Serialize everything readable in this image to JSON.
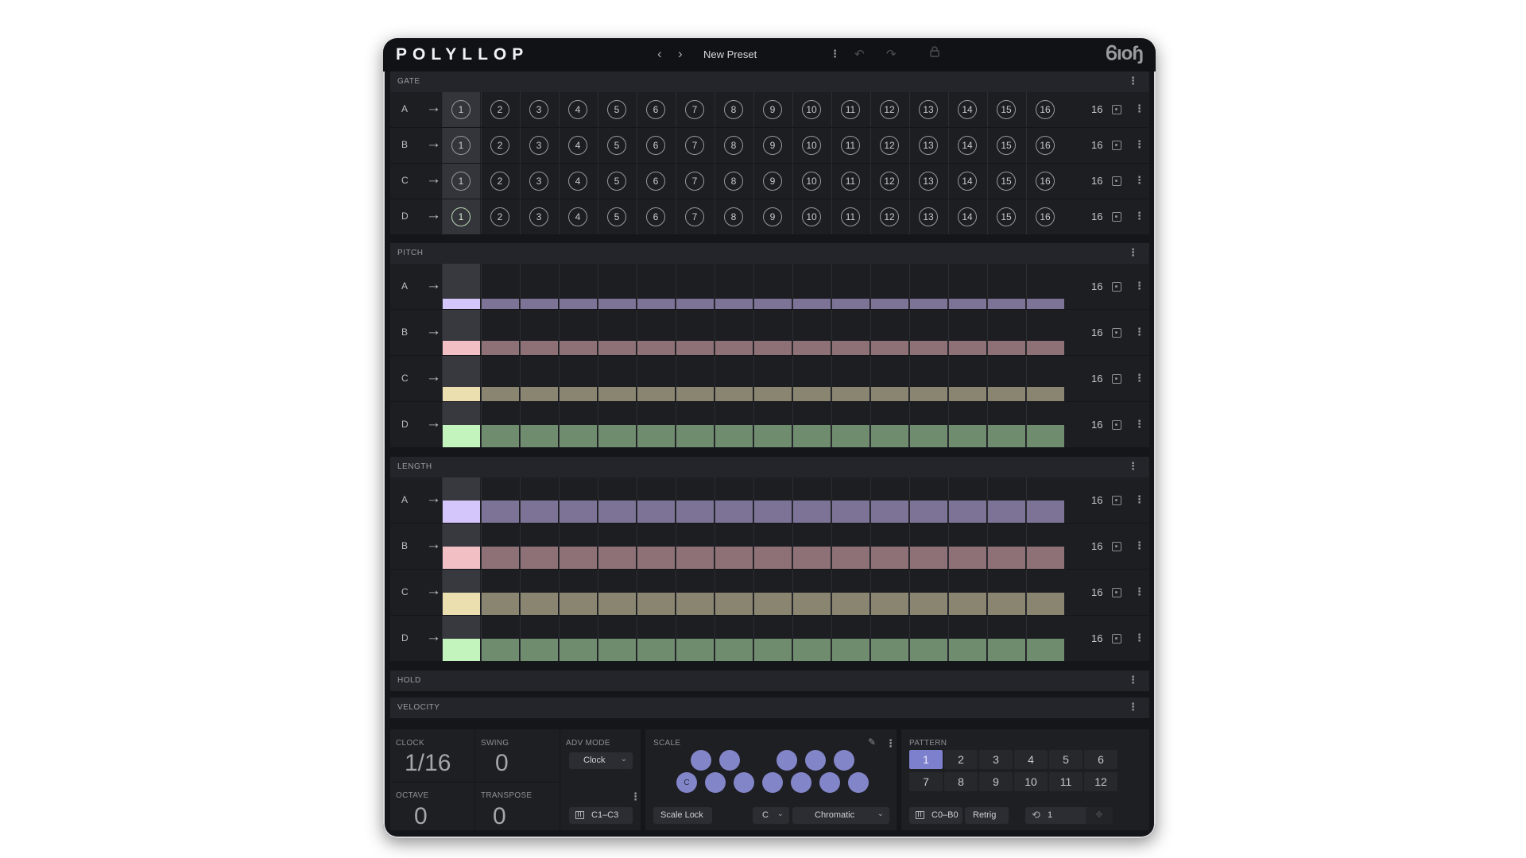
{
  "header": {
    "logo": "POLYLLOP",
    "prev_icon": "chevron-left",
    "next_icon": "chevron-right",
    "preset_name": "New Preset",
    "menu_icon": "kebab",
    "undo_icon": "undo",
    "redo_icon": "redo",
    "lock_icon": "lock",
    "brand": "Ꮾıoɧ"
  },
  "sections": {
    "gate": "GATE",
    "pitch": "PITCH",
    "length": "LENGTH",
    "hold": "HOLD",
    "velocity": "VELOCITY"
  },
  "track_labels": [
    "A",
    "B",
    "C",
    "D"
  ],
  "arrow_glyph": "→",
  "menu_glyph": "⋮",
  "step_count": "16",
  "gate_steps": [
    "1",
    "2",
    "3",
    "4",
    "5",
    "6",
    "7",
    "8",
    "9",
    "10",
    "11",
    "12",
    "13",
    "14",
    "15",
    "16"
  ],
  "lane_colors": {
    "A": {
      "active": "#d4c6fb",
      "dim": "#7c7397"
    },
    "B": {
      "active": "#f2bfc4",
      "dim": "#8d7176"
    },
    "C": {
      "active": "#ebdfb0",
      "dim": "#8a8570"
    },
    "D": {
      "active": "#c3f4bd",
      "dim": "#6f8c6f"
    }
  },
  "pitch_levels": [
    0.38,
    0.38,
    0.38,
    0.55
  ],
  "length_levels": [
    0.55,
    0.55,
    0.55,
    0.55
  ],
  "bottom": {
    "clock_label": "CLOCK",
    "clock_value": "1/16",
    "swing_label": "SWING",
    "swing_value": "0",
    "adv_mode_label": "ADV MODE",
    "adv_mode_value": "Clock",
    "octave_label": "OCTAVE",
    "octave_value": "0",
    "transpose_label": "TRANSPOSE",
    "transpose_value": "0",
    "range_value": "C1–C3",
    "scale_label": "SCALE",
    "scale_root_note": "C",
    "scale_lock": "Scale Lock",
    "key_value": "C",
    "scale_value": "Chromatic",
    "pattern_label": "PATTERN",
    "patterns": [
      "1",
      "2",
      "3",
      "4",
      "5",
      "6",
      "7",
      "8",
      "9",
      "10",
      "11",
      "12"
    ],
    "active_pattern": "1",
    "pattern_range": "C0–B0",
    "retrig": "Retrig",
    "repeat_value": "1"
  }
}
